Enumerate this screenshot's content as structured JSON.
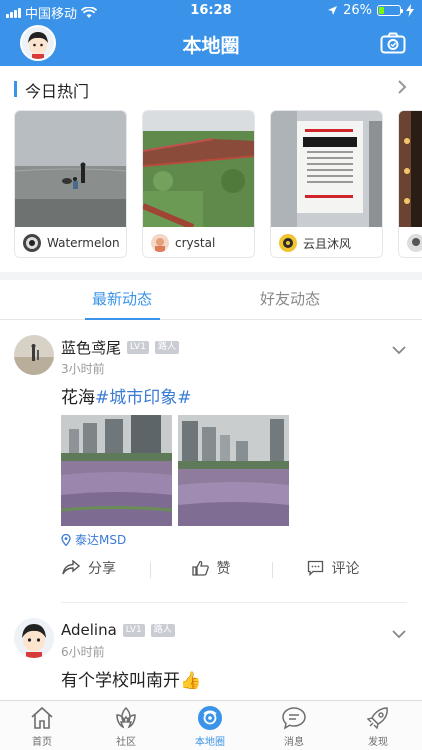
{
  "status": {
    "carrier": "中国移动",
    "time": "16:28",
    "battery": "26%",
    "battery_level": 0.26
  },
  "header": {
    "title": "本地圈"
  },
  "hot": {
    "title": "今日热门",
    "cards": [
      {
        "user": "Watermelon"
      },
      {
        "user": "crystal"
      },
      {
        "user": "云且沐风"
      },
      {
        "user": ""
      }
    ]
  },
  "tabs": [
    {
      "label": "最新动态"
    },
    {
      "label": "好友动态"
    }
  ],
  "posts": [
    {
      "name": "蓝色鸢尾",
      "level": "LV1",
      "rank": "路人",
      "time": "3小时前",
      "text": "花海",
      "topic": "#城市印象#",
      "location": "泰达MSD",
      "actions": {
        "share": "分享",
        "like": "赞",
        "comment": "评论"
      }
    },
    {
      "name": "Adelina",
      "level": "LV1",
      "rank": "路人",
      "time": "6小时前",
      "text": "有个学校叫南开",
      "emoji": "👍"
    }
  ],
  "nav": [
    {
      "label": "首页",
      "icon": "home-icon"
    },
    {
      "label": "社区",
      "icon": "community-icon"
    },
    {
      "label": "本地圈",
      "icon": "local-circle-icon"
    },
    {
      "label": "消息",
      "icon": "message-icon"
    },
    {
      "label": "发现",
      "icon": "discover-icon"
    }
  ],
  "colors": {
    "brand": "#3a93e8",
    "topic": "#3a7bd5",
    "battery": "#7CFC00"
  }
}
